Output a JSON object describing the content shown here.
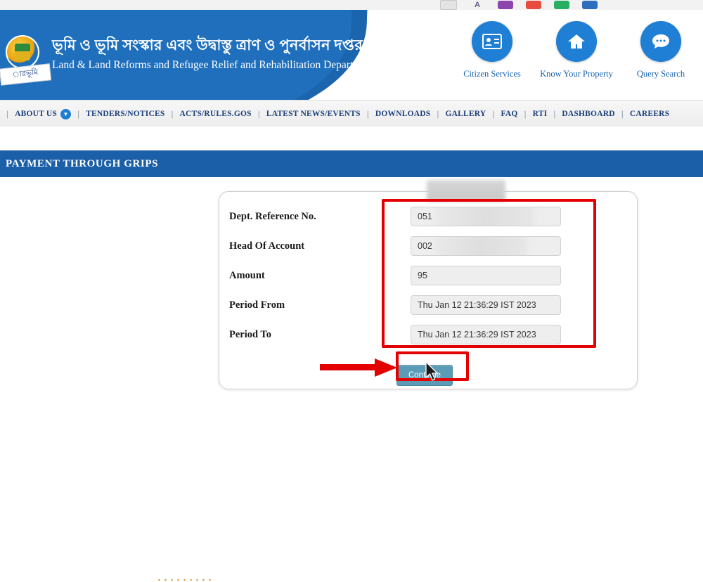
{
  "browser_sliver": {
    "icons": [
      "window-icon",
      "letter-a-icon",
      "purple-app-icon",
      "red-app-icon",
      "green-app-icon",
      "blue-app-icon"
    ]
  },
  "header": {
    "emblem_text": "ারভূমি",
    "title_bn": "ভূমি ও ভূমি সংস্কার এবং উদ্বাস্তু ত্রাণ ও পুনর্বাসন দপ্তর",
    "title_en": "Land & Land Reforms and Refugee Relief and Rehabilitation Department",
    "quick_links": [
      {
        "label": "Citizen Services",
        "icon": "id-card-icon"
      },
      {
        "label": "Know Your Property",
        "icon": "home-icon"
      },
      {
        "label": "Query Search",
        "icon": "chat-bubble-icon"
      }
    ]
  },
  "nav": {
    "items": [
      "ABOUT US",
      "TENDERS/NOTICES",
      "ACTS/RULES.GOS",
      "LATEST NEWS/EVENTS",
      "DOWNLOADS",
      "GALLERY",
      "FAQ",
      "RTI",
      "DASHBOARD",
      "CAREERS"
    ],
    "separator": "|"
  },
  "page_banner": {
    "title": "PAYMENT THROUGH GRIPS"
  },
  "form": {
    "fields": [
      {
        "label": "Dept. Reference No.",
        "value": "051",
        "masked": true
      },
      {
        "label": "Head Of Account",
        "value": "002",
        "masked": true
      },
      {
        "label": "Amount",
        "value": "95",
        "masked": false
      },
      {
        "label": "Period From",
        "value": "Thu Jan 12 21:36:29 IST 2023",
        "masked": false
      },
      {
        "label": "Period To",
        "value": "Thu Jan 12 21:36:29 IST 2023",
        "masked": false
      }
    ],
    "continue_label": "Continue"
  },
  "annotations": {
    "highlight_box": "red-rectangle-around-fields",
    "button_box": "red-rectangle-around-continue",
    "arrow": "red-arrow-pointing-to-continue",
    "cursor": "mouse-pointer-on-continue"
  }
}
